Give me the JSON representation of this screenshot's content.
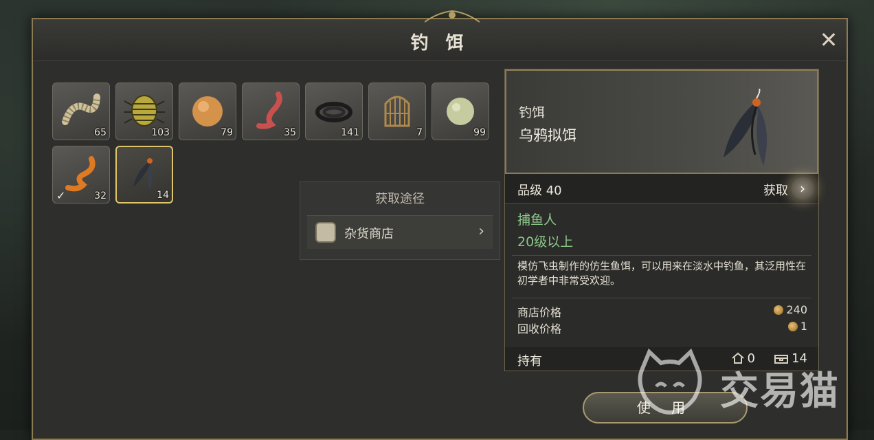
{
  "window": {
    "title": "钓 饵",
    "close_icon": "close-x-icon"
  },
  "inventory": [
    {
      "name": "worm-pale",
      "count": "65",
      "icon": "pale-larva-icon"
    },
    {
      "name": "beetle",
      "count": "103",
      "icon": "beetle-icon"
    },
    {
      "name": "bread-ball",
      "count": "79",
      "icon": "orange-ball-icon"
    },
    {
      "name": "red-worm",
      "count": "35",
      "icon": "red-worm-icon"
    },
    {
      "name": "eel-coil",
      "count": "141",
      "icon": "black-coil-icon"
    },
    {
      "name": "cage",
      "count": "7",
      "icon": "bird-cage-icon"
    },
    {
      "name": "green-ball",
      "count": "99",
      "icon": "green-ball-icon"
    },
    {
      "name": "orange-worm",
      "count": "32",
      "icon": "orange-worm-icon",
      "equipped": true
    },
    {
      "name": "crow-fly",
      "count": "14",
      "icon": "feather-fly-icon",
      "selected": true
    }
  ],
  "source_popup": {
    "title": "获取途径",
    "entry_label": "杂货商店",
    "entry_icon": "shop-bag-icon"
  },
  "detail": {
    "category": "钓饵",
    "item_name": "乌鸦拟饵",
    "grade": "品级 40",
    "obtain_label": "获取",
    "requirement_job": "捕鱼人",
    "requirement_level": "20级以上",
    "description": "模仿飞虫制作的仿生鱼饵，可以用来在淡水中钓鱼，其泛用性在初学者中非常受欢迎。",
    "shop_price_label": "商店价格",
    "shop_price": "240",
    "sell_price_label": "回收价格",
    "sell_price": "1",
    "hold_label": "持有",
    "hold_storage": "0",
    "hold_bag": "14"
  },
  "use_button": "使 用",
  "watermark": "交易猫",
  "colors": {
    "accent_gold": "#e1c56a",
    "req_green": "#8cc78a"
  }
}
